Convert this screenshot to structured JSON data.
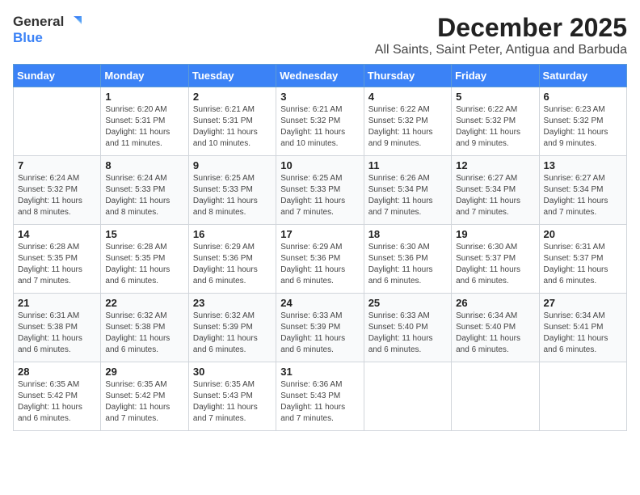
{
  "logo": {
    "general": "General",
    "blue": "Blue"
  },
  "title": "December 2025",
  "subtitle": "All Saints, Saint Peter, Antigua and Barbuda",
  "weekdays": [
    "Sunday",
    "Monday",
    "Tuesday",
    "Wednesday",
    "Thursday",
    "Friday",
    "Saturday"
  ],
  "weeks": [
    [
      {
        "day": "",
        "sunrise": "",
        "sunset": "",
        "daylight": ""
      },
      {
        "day": "1",
        "sunrise": "Sunrise: 6:20 AM",
        "sunset": "Sunset: 5:31 PM",
        "daylight": "Daylight: 11 hours and 11 minutes."
      },
      {
        "day": "2",
        "sunrise": "Sunrise: 6:21 AM",
        "sunset": "Sunset: 5:31 PM",
        "daylight": "Daylight: 11 hours and 10 minutes."
      },
      {
        "day": "3",
        "sunrise": "Sunrise: 6:21 AM",
        "sunset": "Sunset: 5:32 PM",
        "daylight": "Daylight: 11 hours and 10 minutes."
      },
      {
        "day": "4",
        "sunrise": "Sunrise: 6:22 AM",
        "sunset": "Sunset: 5:32 PM",
        "daylight": "Daylight: 11 hours and 9 minutes."
      },
      {
        "day": "5",
        "sunrise": "Sunrise: 6:22 AM",
        "sunset": "Sunset: 5:32 PM",
        "daylight": "Daylight: 11 hours and 9 minutes."
      },
      {
        "day": "6",
        "sunrise": "Sunrise: 6:23 AM",
        "sunset": "Sunset: 5:32 PM",
        "daylight": "Daylight: 11 hours and 9 minutes."
      }
    ],
    [
      {
        "day": "7",
        "sunrise": "Sunrise: 6:24 AM",
        "sunset": "Sunset: 5:32 PM",
        "daylight": "Daylight: 11 hours and 8 minutes."
      },
      {
        "day": "8",
        "sunrise": "Sunrise: 6:24 AM",
        "sunset": "Sunset: 5:33 PM",
        "daylight": "Daylight: 11 hours and 8 minutes."
      },
      {
        "day": "9",
        "sunrise": "Sunrise: 6:25 AM",
        "sunset": "Sunset: 5:33 PM",
        "daylight": "Daylight: 11 hours and 8 minutes."
      },
      {
        "day": "10",
        "sunrise": "Sunrise: 6:25 AM",
        "sunset": "Sunset: 5:33 PM",
        "daylight": "Daylight: 11 hours and 7 minutes."
      },
      {
        "day": "11",
        "sunrise": "Sunrise: 6:26 AM",
        "sunset": "Sunset: 5:34 PM",
        "daylight": "Daylight: 11 hours and 7 minutes."
      },
      {
        "day": "12",
        "sunrise": "Sunrise: 6:27 AM",
        "sunset": "Sunset: 5:34 PM",
        "daylight": "Daylight: 11 hours and 7 minutes."
      },
      {
        "day": "13",
        "sunrise": "Sunrise: 6:27 AM",
        "sunset": "Sunset: 5:34 PM",
        "daylight": "Daylight: 11 hours and 7 minutes."
      }
    ],
    [
      {
        "day": "14",
        "sunrise": "Sunrise: 6:28 AM",
        "sunset": "Sunset: 5:35 PM",
        "daylight": "Daylight: 11 hours and 7 minutes."
      },
      {
        "day": "15",
        "sunrise": "Sunrise: 6:28 AM",
        "sunset": "Sunset: 5:35 PM",
        "daylight": "Daylight: 11 hours and 6 minutes."
      },
      {
        "day": "16",
        "sunrise": "Sunrise: 6:29 AM",
        "sunset": "Sunset: 5:36 PM",
        "daylight": "Daylight: 11 hours and 6 minutes."
      },
      {
        "day": "17",
        "sunrise": "Sunrise: 6:29 AM",
        "sunset": "Sunset: 5:36 PM",
        "daylight": "Daylight: 11 hours and 6 minutes."
      },
      {
        "day": "18",
        "sunrise": "Sunrise: 6:30 AM",
        "sunset": "Sunset: 5:36 PM",
        "daylight": "Daylight: 11 hours and 6 minutes."
      },
      {
        "day": "19",
        "sunrise": "Sunrise: 6:30 AM",
        "sunset": "Sunset: 5:37 PM",
        "daylight": "Daylight: 11 hours and 6 minutes."
      },
      {
        "day": "20",
        "sunrise": "Sunrise: 6:31 AM",
        "sunset": "Sunset: 5:37 PM",
        "daylight": "Daylight: 11 hours and 6 minutes."
      }
    ],
    [
      {
        "day": "21",
        "sunrise": "Sunrise: 6:31 AM",
        "sunset": "Sunset: 5:38 PM",
        "daylight": "Daylight: 11 hours and 6 minutes."
      },
      {
        "day": "22",
        "sunrise": "Sunrise: 6:32 AM",
        "sunset": "Sunset: 5:38 PM",
        "daylight": "Daylight: 11 hours and 6 minutes."
      },
      {
        "day": "23",
        "sunrise": "Sunrise: 6:32 AM",
        "sunset": "Sunset: 5:39 PM",
        "daylight": "Daylight: 11 hours and 6 minutes."
      },
      {
        "day": "24",
        "sunrise": "Sunrise: 6:33 AM",
        "sunset": "Sunset: 5:39 PM",
        "daylight": "Daylight: 11 hours and 6 minutes."
      },
      {
        "day": "25",
        "sunrise": "Sunrise: 6:33 AM",
        "sunset": "Sunset: 5:40 PM",
        "daylight": "Daylight: 11 hours and 6 minutes."
      },
      {
        "day": "26",
        "sunrise": "Sunrise: 6:34 AM",
        "sunset": "Sunset: 5:40 PM",
        "daylight": "Daylight: 11 hours and 6 minutes."
      },
      {
        "day": "27",
        "sunrise": "Sunrise: 6:34 AM",
        "sunset": "Sunset: 5:41 PM",
        "daylight": "Daylight: 11 hours and 6 minutes."
      }
    ],
    [
      {
        "day": "28",
        "sunrise": "Sunrise: 6:35 AM",
        "sunset": "Sunset: 5:42 PM",
        "daylight": "Daylight: 11 hours and 6 minutes."
      },
      {
        "day": "29",
        "sunrise": "Sunrise: 6:35 AM",
        "sunset": "Sunset: 5:42 PM",
        "daylight": "Daylight: 11 hours and 7 minutes."
      },
      {
        "day": "30",
        "sunrise": "Sunrise: 6:35 AM",
        "sunset": "Sunset: 5:43 PM",
        "daylight": "Daylight: 11 hours and 7 minutes."
      },
      {
        "day": "31",
        "sunrise": "Sunrise: 6:36 AM",
        "sunset": "Sunset: 5:43 PM",
        "daylight": "Daylight: 11 hours and 7 minutes."
      },
      {
        "day": "",
        "sunrise": "",
        "sunset": "",
        "daylight": ""
      },
      {
        "day": "",
        "sunrise": "",
        "sunset": "",
        "daylight": ""
      },
      {
        "day": "",
        "sunrise": "",
        "sunset": "",
        "daylight": ""
      }
    ]
  ]
}
